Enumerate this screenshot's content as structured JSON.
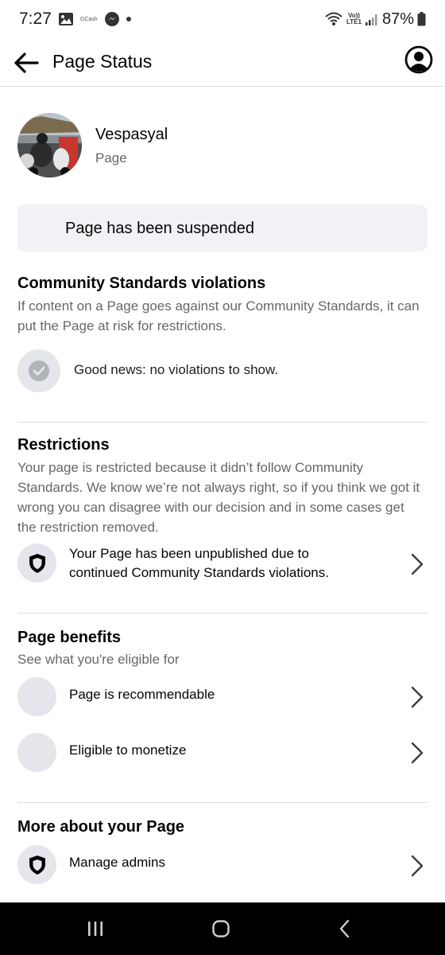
{
  "status_bar": {
    "time": "7:27",
    "gcash_label": "GCash",
    "volte_line1": "Vo))",
    "volte_line2": "LTE1",
    "battery": "87%"
  },
  "header": {
    "title": "Page Status"
  },
  "page": {
    "name": "Vespasyal",
    "type": "Page"
  },
  "banner": {
    "text": "Page has been suspended"
  },
  "community": {
    "title": "Community Standards violations",
    "description": "If content on a Page goes against our Community Standards, it can put the Page at risk for restrictions.",
    "status": "Good news: no violations to show."
  },
  "restrictions": {
    "title": "Restrictions",
    "description": "Your page is restricted because it didn’t follow Community Standards. We know we’re not always right, so if you think we got it wrong you can disagree with our decision and in some cases get the restriction removed.",
    "item_line1": "Your Page has been unpublished due to",
    "item_line2": "continued Community Standards violations."
  },
  "benefits": {
    "title": "Page benefits",
    "subtitle": "See what you're eligible for",
    "items": [
      {
        "label": "Page is recommendable"
      },
      {
        "label": "Eligible to monetize"
      }
    ]
  },
  "more": {
    "title": "More about your Page",
    "items": [
      {
        "label": "Manage admins"
      }
    ]
  },
  "colors": {
    "background": "#ffffff",
    "banner_bg": "#f0f2f5",
    "icon_circle": "#e4e6eb",
    "muted_text": "#65676b",
    "nav_bar": "#000000"
  },
  "icons": [
    "back-arrow-icon",
    "profile-icon",
    "check-icon",
    "shield-icon",
    "chevron-right-icon",
    "recents-icon",
    "home-icon",
    "nav-back-icon"
  ]
}
